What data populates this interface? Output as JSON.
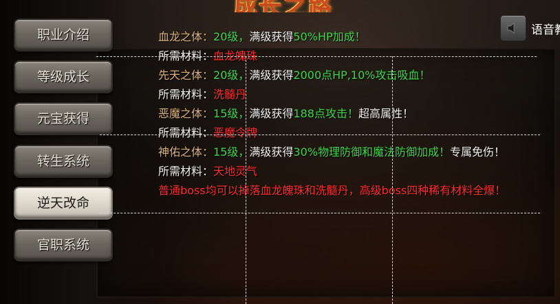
{
  "title": "成长之路",
  "nav": {
    "items": [
      {
        "label": "职业介绍",
        "active": false
      },
      {
        "label": "等级成长",
        "active": false
      },
      {
        "label": "元宝获得",
        "active": false
      },
      {
        "label": "转生系统",
        "active": false
      },
      {
        "label": "逆天改命",
        "active": true
      },
      {
        "label": "官职系统",
        "active": false
      }
    ]
  },
  "voice": {
    "label": "语音教",
    "icon": "speaker-icon"
  },
  "content": {
    "lines": [
      [
        {
          "t": "血龙之体：",
          "c": "gold"
        },
        {
          "t": "20级，",
          "c": "green"
        },
        {
          "t": "满级获得",
          "c": "white"
        },
        {
          "t": "50%HP加成！",
          "c": "green"
        }
      ],
      [
        {
          "t": "所需材料：",
          "c": "white"
        },
        {
          "t": "血龙魄珠",
          "c": "red"
        }
      ],
      [
        {
          "t": "先天之体：",
          "c": "gold"
        },
        {
          "t": "20级，",
          "c": "green"
        },
        {
          "t": "满级获得",
          "c": "white"
        },
        {
          "t": "2000点HP,10%攻击吸血！",
          "c": "green"
        }
      ],
      [
        {
          "t": "所需材料：",
          "c": "white"
        },
        {
          "t": "洗髓丹",
          "c": "red"
        }
      ],
      [
        {
          "t": "恶魔之体：",
          "c": "gold"
        },
        {
          "t": "15级，",
          "c": "green"
        },
        {
          "t": "满级获得",
          "c": "white"
        },
        {
          "t": "188点攻击！",
          "c": "green"
        },
        {
          "t": "超高属性！",
          "c": "white"
        }
      ],
      [
        {
          "t": "所需材料：",
          "c": "white"
        },
        {
          "t": "恶魔令牌",
          "c": "red"
        }
      ],
      [
        {
          "t": "神佑之体：",
          "c": "gold"
        },
        {
          "t": "15级，",
          "c": "green"
        },
        {
          "t": "满级获得",
          "c": "white"
        },
        {
          "t": "30%物理防御和魔法防御加成！",
          "c": "green"
        },
        {
          "t": "专属免伤！",
          "c": "white"
        }
      ],
      [
        {
          "t": "所需材料：",
          "c": "white"
        },
        {
          "t": "天地灵气",
          "c": "red"
        }
      ],
      [
        {
          "t": "普通boss均可以掉落血龙魄珠和洗髓丹，高级boss四种稀有材料全爆！",
          "c": "red"
        }
      ]
    ]
  }
}
